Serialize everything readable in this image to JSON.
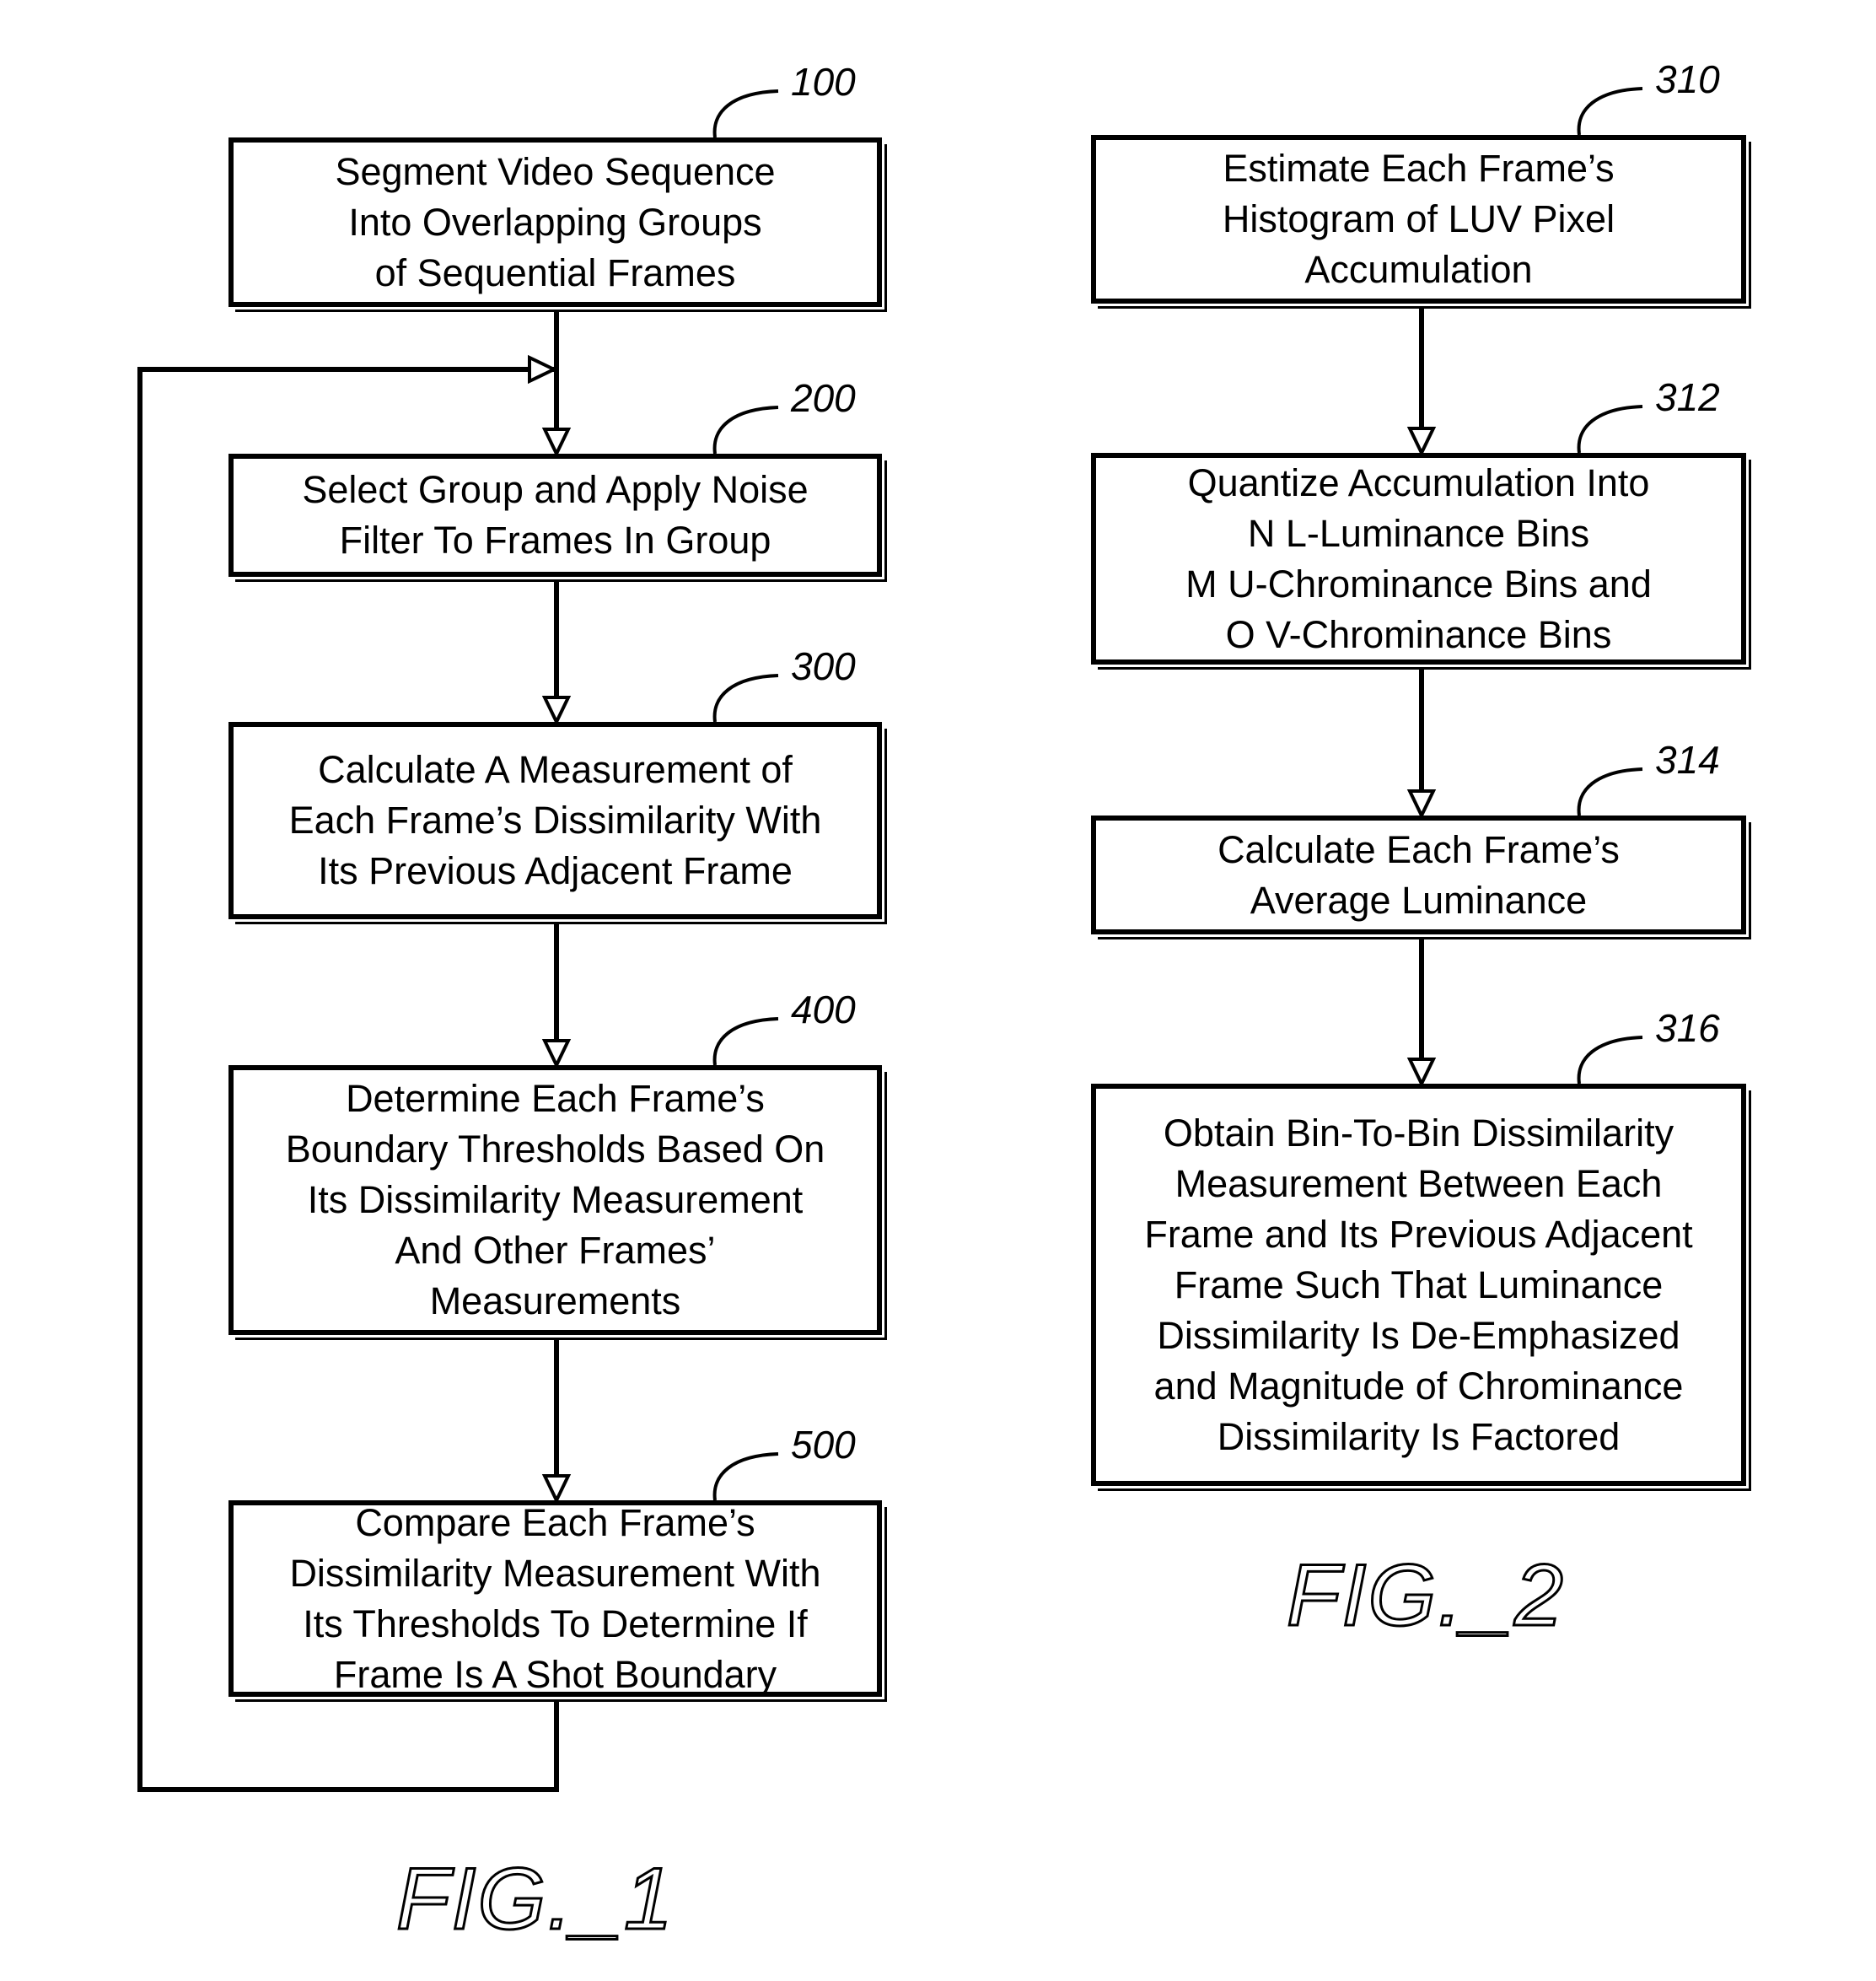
{
  "figures": [
    {
      "id": "fig1",
      "label": "FIG._1",
      "steps": [
        {
          "ref": "100",
          "lines": [
            "Segment Video Sequence",
            "Into Overlapping Groups",
            "of Sequential Frames"
          ]
        },
        {
          "ref": "200",
          "lines": [
            "Select Group and Apply Noise",
            "Filter To Frames In Group"
          ]
        },
        {
          "ref": "300",
          "lines": [
            "Calculate A Measurement of",
            "Each Frame’s Dissimilarity With",
            "Its Previous Adjacent Frame"
          ]
        },
        {
          "ref": "400",
          "lines": [
            "Determine Each Frame’s",
            "Boundary Thresholds Based On",
            "Its Dissimilarity Measurement",
            "And Other Frames’",
            "Measurements"
          ]
        },
        {
          "ref": "500",
          "lines": [
            "Compare Each Frame’s",
            "Dissimilarity Measurement With",
            "Its Thresholds To Determine If",
            "Frame Is A Shot Boundary"
          ]
        }
      ],
      "loop": {
        "from": "500",
        "to": "200"
      }
    },
    {
      "id": "fig2",
      "label": "FIG._2",
      "steps": [
        {
          "ref": "310",
          "lines": [
            "Estimate Each Frame’s",
            "Histogram of LUV Pixel",
            "Accumulation"
          ]
        },
        {
          "ref": "312",
          "lines": [
            "Quantize Accumulation Into",
            "N L-Luminance Bins",
            "M U-Chrominance Bins and",
            "O V-Chrominance Bins"
          ]
        },
        {
          "ref": "314",
          "lines": [
            "Calculate Each Frame’s",
            "Average Luminance"
          ]
        },
        {
          "ref": "316",
          "lines": [
            "Obtain Bin-To-Bin Dissimilarity",
            "Measurement Between Each",
            "Frame and Its Previous Adjacent",
            "Frame Such That Luminance",
            "Dissimilarity Is De-Emphasized",
            "and Magnitude of Chrominance",
            "Dissimilarity Is Factored"
          ]
        }
      ]
    }
  ]
}
